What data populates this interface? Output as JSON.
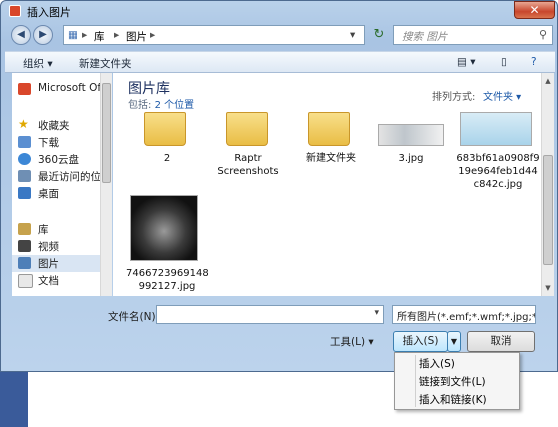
{
  "window": {
    "title": "插入图片",
    "close_label": "✕"
  },
  "address": {
    "seg1": "库",
    "seg2": "图片",
    "search_placeholder": "搜索 图片"
  },
  "toolbar": {
    "organize": "组织 ▾",
    "new_folder": "新建文件夹"
  },
  "nav": {
    "items": [
      {
        "label": "Microsoft Of"
      },
      {
        "label": "收藏夹"
      },
      {
        "label": "下载"
      },
      {
        "label": "360云盘"
      },
      {
        "label": "最近访问的位"
      },
      {
        "label": "桌面"
      },
      {
        "label": "库"
      },
      {
        "label": "视频"
      },
      {
        "label": "图片"
      },
      {
        "label": "文档"
      }
    ]
  },
  "library": {
    "title": "图片库",
    "includes": "包括:",
    "locations": "2 个位置",
    "arrange_label": "排列方式:",
    "arrange_value": "文件夹 ▾"
  },
  "items": [
    {
      "label": "2"
    },
    {
      "label1": "Raptr",
      "label2": "Screenshots"
    },
    {
      "label": "新建文件夹"
    },
    {
      "label": "3.jpg"
    },
    {
      "label1": "683bf61a0908f9",
      "label2": "19e964feb1d44",
      "label3": "c842c.jpg"
    },
    {
      "label1": "7466723969148",
      "label2": "992127.jpg"
    }
  ],
  "bottom": {
    "filename_label": "文件名(N):",
    "filename_value": "",
    "filter": "所有图片(*.emf;*.wmf;*.jpg;*.j",
    "tools": "工具(L) ▾",
    "insert": "插入(S)",
    "cancel": "取消"
  },
  "menu": {
    "items": [
      "插入(S)",
      "链接到文件(L)",
      "插入和链接(K)"
    ]
  }
}
